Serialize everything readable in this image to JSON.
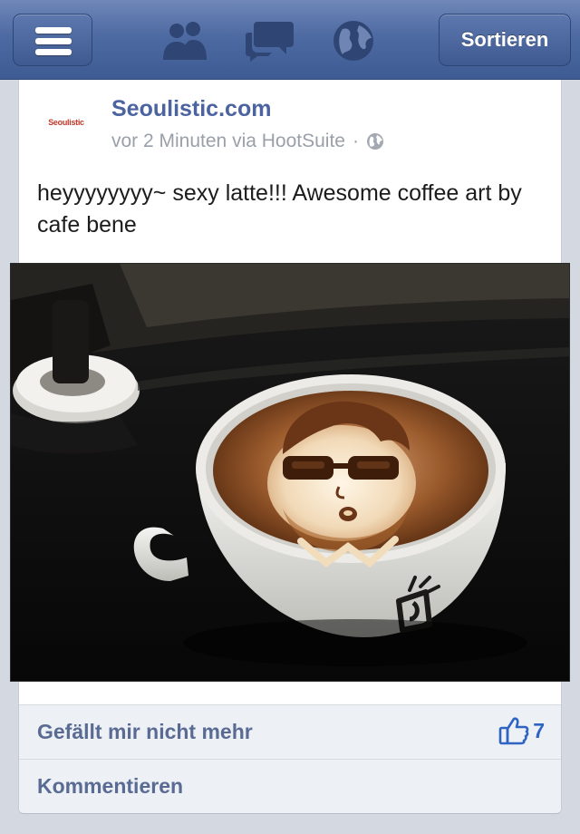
{
  "navbar": {
    "menu_icon": "hamburger-menu-icon",
    "friends_icon": "friends-icon",
    "messages_icon": "chat-bubbles-icon",
    "notifications_icon": "globe-icon",
    "sort_label": "Sortieren"
  },
  "post": {
    "author": "Seoulistic.com",
    "avatar_text": "Seoulistic",
    "time_label": "vor 2 Minuten via HootSuite",
    "separator": "·",
    "privacy_icon": "globe-icon",
    "text": "heyyyyyyyy~ sexy latte!!! Awesome coffee art by cafe bene",
    "photo_description_icon": "photo-icon"
  },
  "actions": {
    "unlike_label": "Gefällt mir nicht mehr",
    "like_count": "7",
    "comment_label": "Kommentieren"
  },
  "colors": {
    "navbar": "#4e6aa2",
    "author": "#4b63a0",
    "action_text": "#5a6b93",
    "like_blue": "#2f64c4"
  }
}
